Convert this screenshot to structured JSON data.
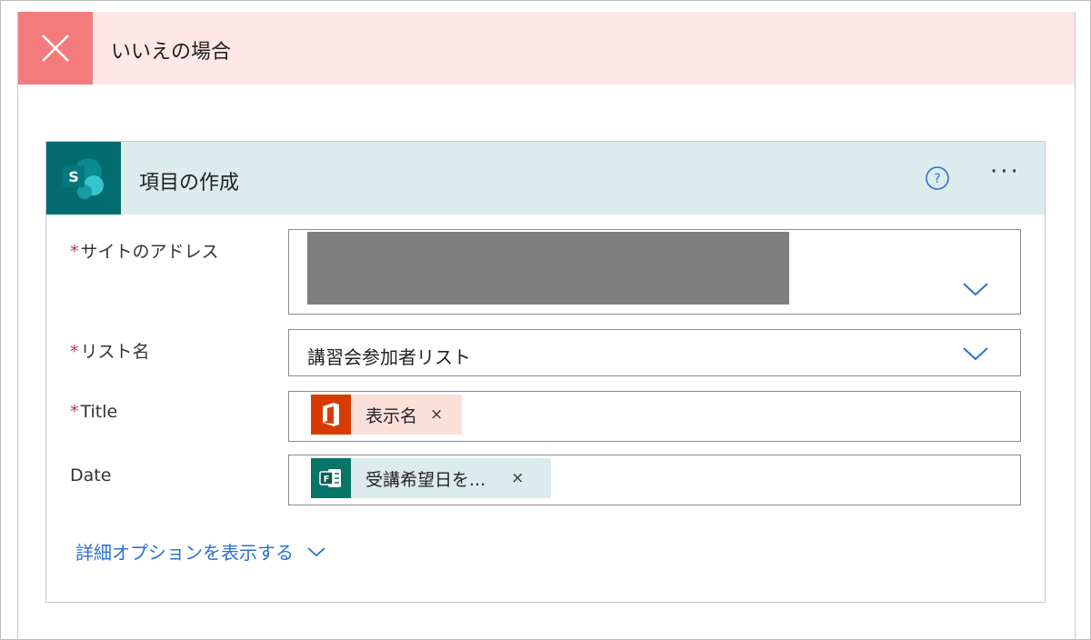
{
  "branch": {
    "title": "いいえの場合",
    "icon": "close-icon",
    "color": "#f47b7b",
    "header_bg": "#fde7e7"
  },
  "action": {
    "title": "項目の作成",
    "icon": "sharepoint-icon",
    "icon_color": "#036c70",
    "header_bg": "#dcebeb",
    "help_icon": "help-circle-icon",
    "more_icon": "more-options-icon",
    "more_label": "···"
  },
  "fields": {
    "site_address": {
      "required_mark": "*",
      "label": "サイトのアドレス",
      "value_redacted": true
    },
    "list_name": {
      "required_mark": "*",
      "label": "リスト名",
      "value": "講習会参加者リスト"
    },
    "title": {
      "required_mark": "*",
      "label": "Title",
      "token": {
        "icon": "office-icon",
        "text": "表示名",
        "remove": "×"
      }
    },
    "date": {
      "label": "Date",
      "token": {
        "icon": "forms-icon",
        "text": "受講希望日を...",
        "remove": "×"
      }
    }
  },
  "advanced_options": {
    "label": "詳細オプションを表示する",
    "icon": "chevron-down-icon"
  },
  "colors": {
    "link": "#2a6fd6",
    "required": "#c4314b",
    "office": "#d83b01",
    "forms": "#077568"
  }
}
